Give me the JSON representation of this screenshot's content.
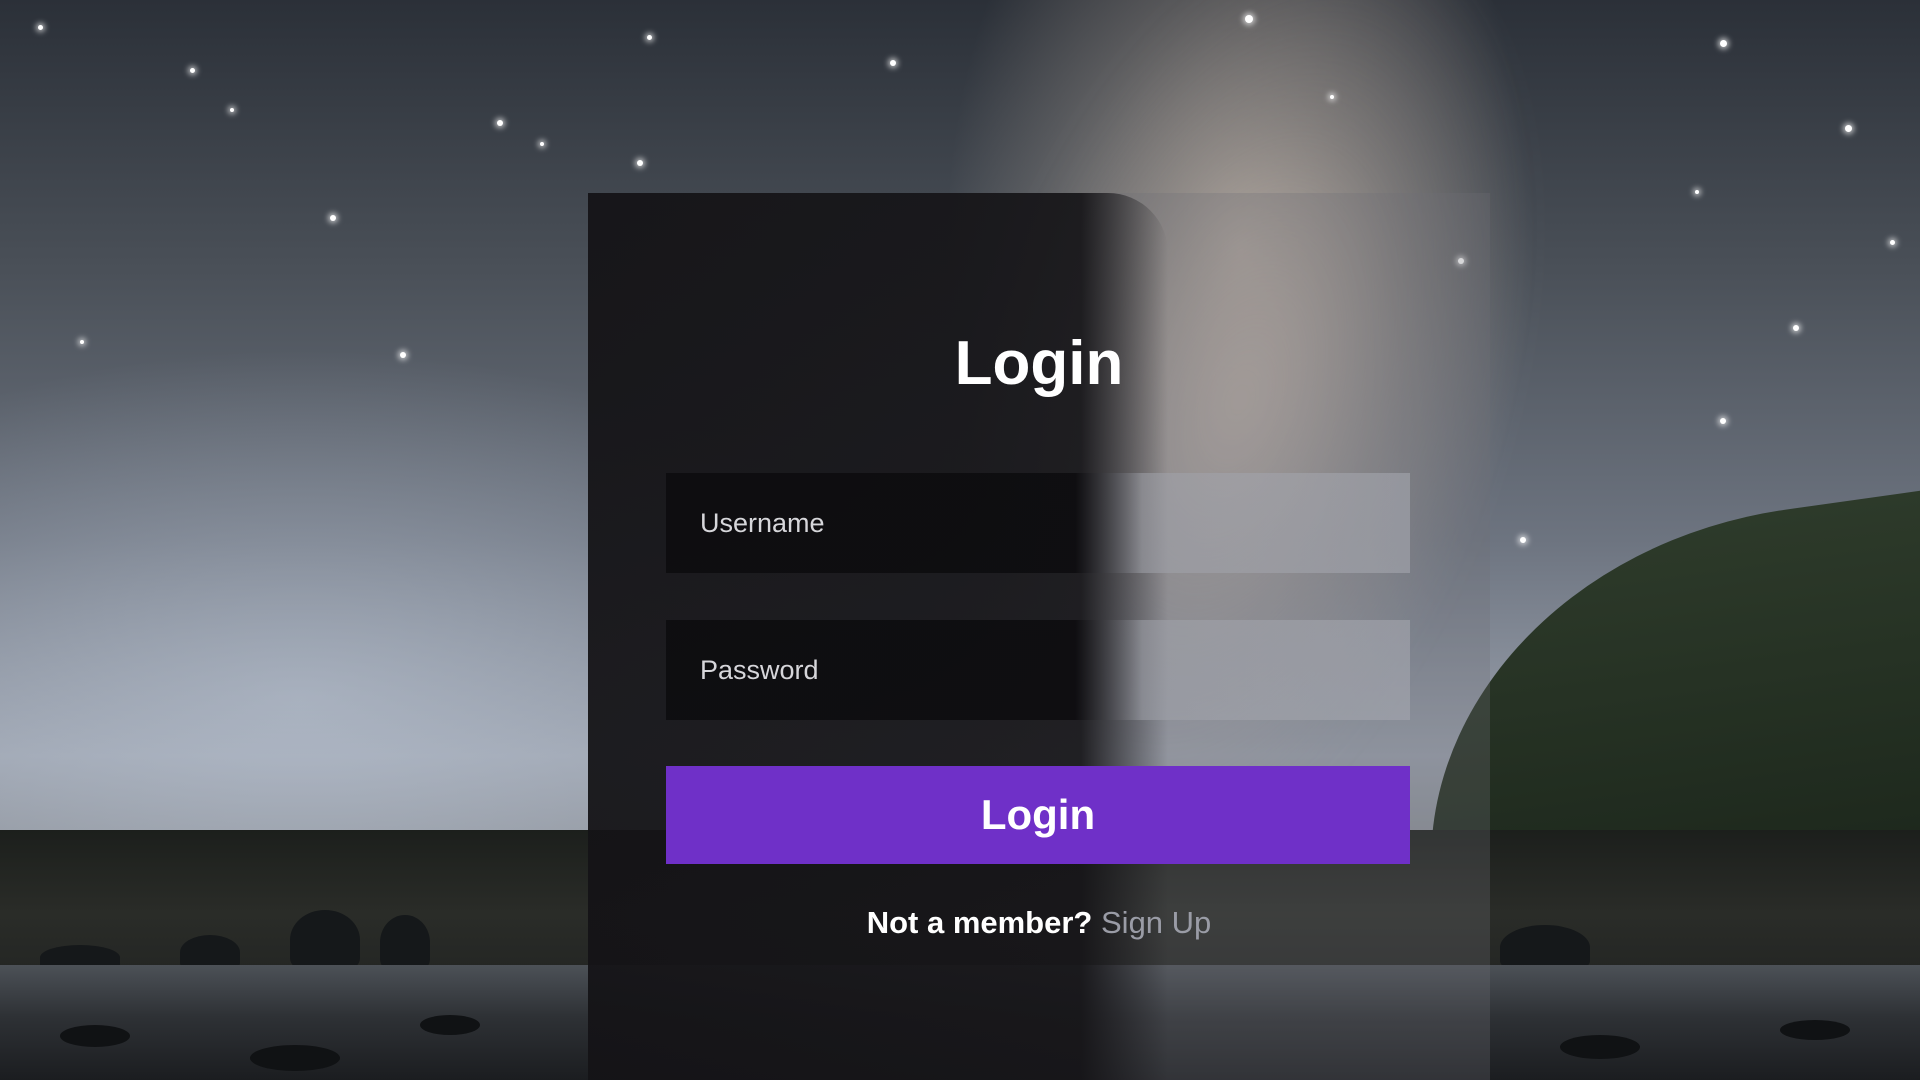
{
  "login_form": {
    "title": "Login",
    "username_placeholder": "Username",
    "password_placeholder": "Password",
    "submit_label": "Login",
    "signup_prompt": "Not a member?",
    "signup_link": "Sign Up"
  },
  "colors": {
    "accent": "#6f30c8",
    "panel_dark": "#141316",
    "text": "#ffffff",
    "link": "#9a9ca6"
  }
}
